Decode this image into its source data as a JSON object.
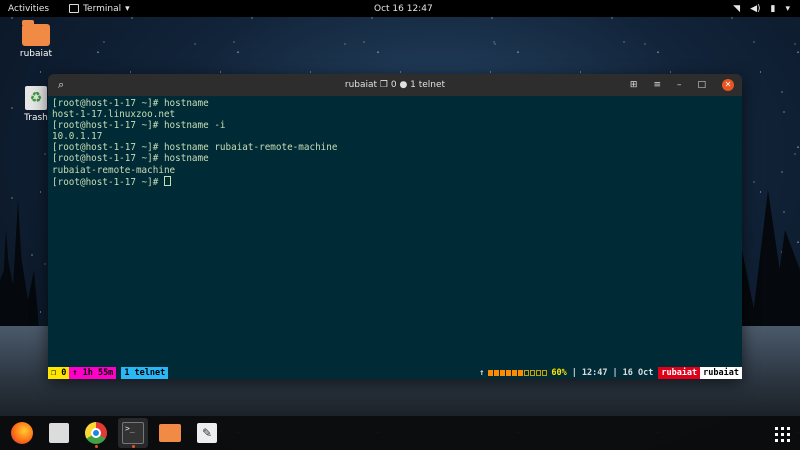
{
  "topbar": {
    "activities": "Activities",
    "app_name": "Terminal",
    "app_menu_icon": "terminal-icon",
    "clock": "Oct 16  12:47",
    "tray_icons": [
      "wifi-icon",
      "volume-icon",
      "battery-icon",
      "chevron-down-icon"
    ]
  },
  "desktop": {
    "icons": [
      {
        "label": "rubaiat",
        "icon": "home-folder-icon"
      },
      {
        "label": "Trash",
        "icon": "trash-icon"
      }
    ]
  },
  "terminal": {
    "window_title": "rubaiat ❐ 0 ● 1 telnet",
    "lines": [
      "[root@host-1-17 ~]# hostname",
      "host-1-17.linuxzoo.net",
      "[root@host-1-17 ~]# hostname -i",
      "10.0.1.17",
      "[root@host-1-17 ~]# hostname rubaiat-remote-machine",
      "[root@host-1-17 ~]# hostname",
      "rubaiat-remote-machine"
    ],
    "prompt": "[root@host-1-17 ~]# ",
    "status": {
      "window": "❐ 0",
      "uptime": "↑ 1h 55m",
      "tab": "1 telnet",
      "mem_arrow": "↑",
      "mem_level": 0.6,
      "mem_percent": "60%",
      "sep1": "|",
      "time": "12:47",
      "sep2": "|",
      "date": "16 Oct",
      "user": "rubaiat",
      "host": "rubaiat"
    }
  },
  "dock": {
    "items": [
      {
        "name": "firefox"
      },
      {
        "name": "files"
      },
      {
        "name": "chrome"
      },
      {
        "name": "terminal",
        "active": true
      },
      {
        "name": "folder"
      },
      {
        "name": "text-editor"
      }
    ],
    "apps_icon": "show-applications-icon"
  },
  "colors": {
    "terminal_bg": "#002b36",
    "terminal_fg": "#c6ddb5",
    "close_button": "#e95420",
    "tmux_user": "#e0001a"
  }
}
